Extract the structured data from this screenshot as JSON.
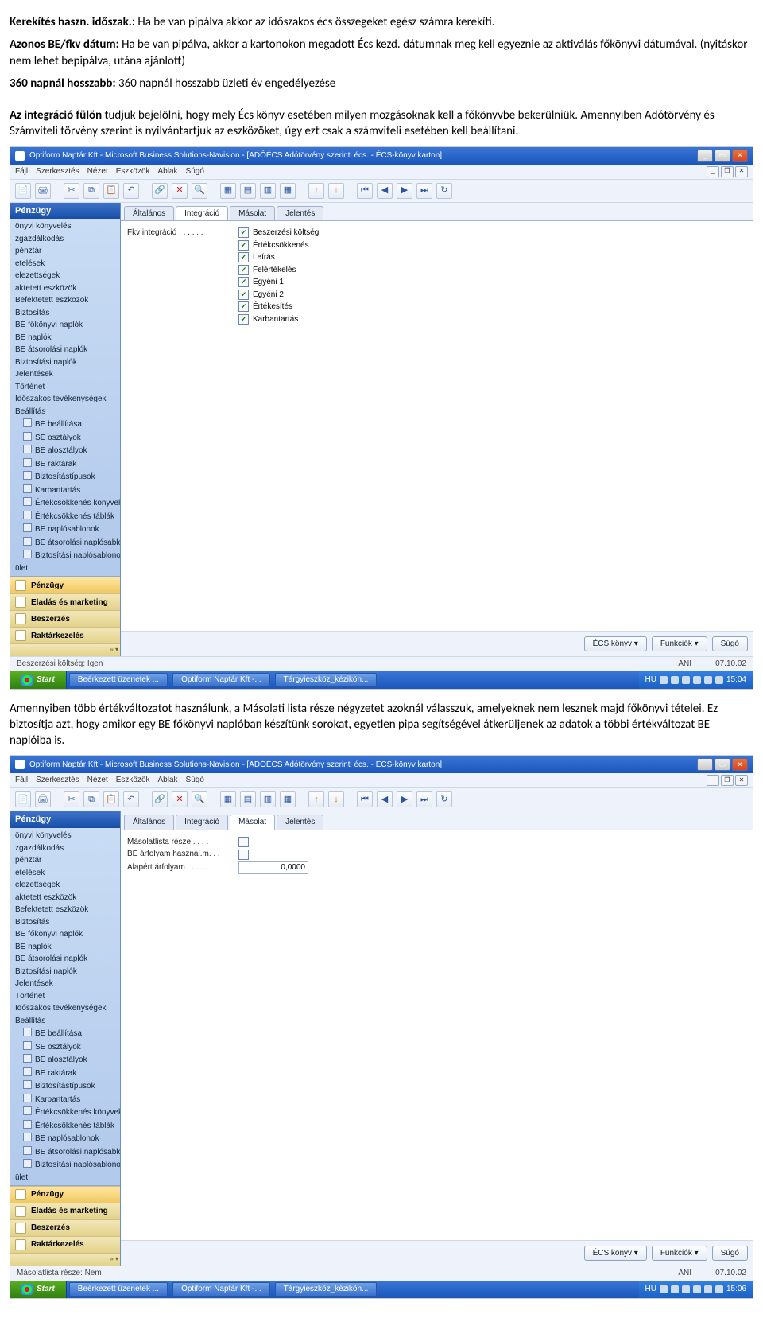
{
  "doc": {
    "p1_bold": "Kerekítés haszn. időszak.:",
    "p1_rest": "  Ha be van pipálva akkor az időszakos écs összegeket egész számra kerekíti.",
    "p2_bold": "Azonos BE/fkv dátum:",
    "p2_rest": "  Ha be van pipálva, akkor a kartonokon megadott Écs kezd. dátumnak meg kell egyeznie az aktiválás főkönyvi dátumával. (nyitáskor nem lehet bepipálva, utána ajánlott)",
    "p3_bold": "360 napnál hosszabb:",
    "p3_rest": " 360 napnál hosszabb üzleti év engedélyezése",
    "p4_bold": "Az integráció fülön",
    "p4_rest": " tudjuk bejelölni, hogy mely Écs könyv esetében milyen mozgásoknak kell a főkönyvbe bekerülniük. Amennyiben Adótörvény és Számviteli törvény szerint is nyilvántartjuk az eszközöket, úgy ezt csak a számviteli esetében kell beállítani.",
    "p5": "Amennyiben több értékváltozatot használunk, a Másolati lista része négyzetet azoknál válasszuk, amelyeknek nem lesznek majd főkönyvi tételei. Ez biztosítja azt, hogy amikor egy BE főkönyvi naplóban készítünk sorokat, egyetlen pipa segítségével átkerüljenek az adatok a többi értékváltozat BE naplóiba is."
  },
  "win": {
    "title": "Optiform Naptár Kft - Microsoft Business Solutions-Navision - [ADÓÉCS Adótörvény szerinti écs. - ÉCS-könyv karton]",
    "menus": [
      "Fájl",
      "Szerkesztés",
      "Nézet",
      "Eszközök",
      "Ablak",
      "Súgó"
    ],
    "sidebar_title": "Pénzügy",
    "sidebar_items": [
      "önyvi könyvelés",
      "zgazdálkodás",
      "pénztár",
      "etelések",
      "elezettségek",
      "aktetett eszközök",
      "Befektetett eszközök",
      "Biztosítás",
      "BE főkönyvi naplók",
      "BE naplók",
      "BE átsorolási naplók",
      "Biztosítási naplók",
      "Jelentések",
      "Történet",
      "Időszakos tevékenységek",
      "Beállítás"
    ],
    "sidebar_sub": [
      "BE beállítása",
      "SE osztályok",
      "BE alosztályok",
      "BE raktárak",
      "Biztosítástípusok",
      "Karbantartás",
      "Értékcsökkenés könyvek",
      "Értékcsökkenés táblák",
      "BE naplósablonok",
      "BE átsorolási naplósablonok",
      "Biztosítási naplósablonok"
    ],
    "sidebar_tail": "ület",
    "sb_buttons": [
      "Pénzügy",
      "Eladás és marketing",
      "Beszerzés",
      "Raktárkezelés"
    ],
    "tabs": [
      "Általános",
      "Integráció",
      "Másolat",
      "Jelentés"
    ],
    "footer_buttons": [
      "ÉCS könyv ▾",
      "Funkciók ▾",
      "Súgó"
    ]
  },
  "shot1": {
    "active_tab": 1,
    "group_label": "Fkv integráció . . . . . .",
    "options": [
      "Beszerzési költség",
      "Értékcsökkenés",
      "Leírás",
      "Felértékelés",
      "Egyéni 1",
      "Egyéni 2",
      "Értékesítés",
      "Karbantartás"
    ],
    "status_left": "Beszerzési költség: Igen",
    "status_user": "ANI",
    "status_date": "07.10.02",
    "task_items": [
      "Beérkezett üzenetek ...",
      "Optiform Naptár Kft -...",
      "Tárgyieszköz_kézikön..."
    ],
    "tray_text": "HU",
    "time": "15:04"
  },
  "shot2": {
    "active_tab": 2,
    "rows": [
      {
        "label": "Másolatlista része . . . .",
        "type": "chk",
        "checked": false
      },
      {
        "label": "BE árfolyam használ.m. . .",
        "type": "chk",
        "checked": false
      },
      {
        "label": "Alapért.árfolyam . . . . .",
        "type": "txt",
        "value": "0,0000"
      }
    ],
    "status_left": "Másolatlista része: Nem",
    "status_user": "ANI",
    "status_date": "07.10.02",
    "task_items": [
      "Beérkezett üzenetek ...",
      "Optiform Naptár Kft -...",
      "Tárgyieszköz_kézikön..."
    ],
    "tray_text": "HU",
    "time": "15:06"
  }
}
